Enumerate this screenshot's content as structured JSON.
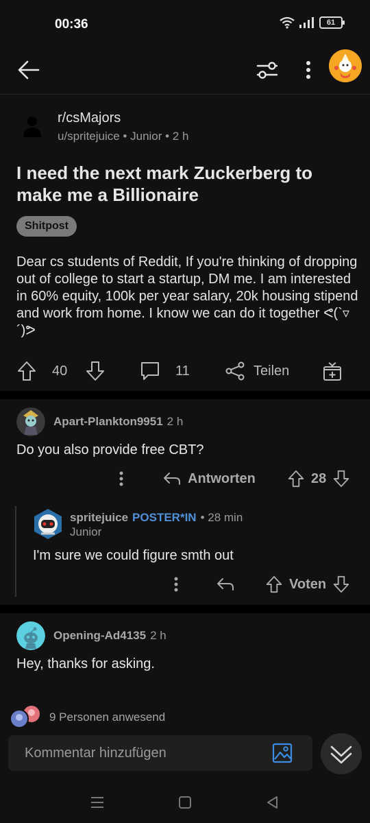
{
  "status": {
    "time": "00:36",
    "battery": "61"
  },
  "post": {
    "subreddit": "r/csMajors",
    "meta": "u/spritejuice • Junior • 2 h",
    "title": "I need the next mark Zuckerberg to make me a Billionaire",
    "flair": "Shitpost",
    "body": "Dear cs students of Reddit, If you're thinking of dropping out of college to start a startup, DM me. I am interested in 60% equity, 100k per year salary, 20k housing stipend and work from home. I know we can do it together ᕙ(`▿´)ᕗ",
    "upvotes": "40",
    "comments": "11",
    "share_label": "Teilen"
  },
  "comments": [
    {
      "user": "Apart-Plankton9951",
      "time": "2 h",
      "text": "Do you also provide free CBT?",
      "reply_label": "Antworten",
      "votes": "28"
    },
    {
      "user": "spritejuice",
      "badge": "POSTER*IN",
      "time": "• 28 min",
      "flair": "Junior",
      "text": "I'm sure we could figure smth out",
      "vote_label": "Voten"
    },
    {
      "user": "Opening-Ad4135",
      "time": "2 h",
      "text": "Hey, thanks for asking."
    }
  ],
  "presence": "9 Personen anwesend",
  "comment_placeholder": "Kommentar hinzufügen"
}
